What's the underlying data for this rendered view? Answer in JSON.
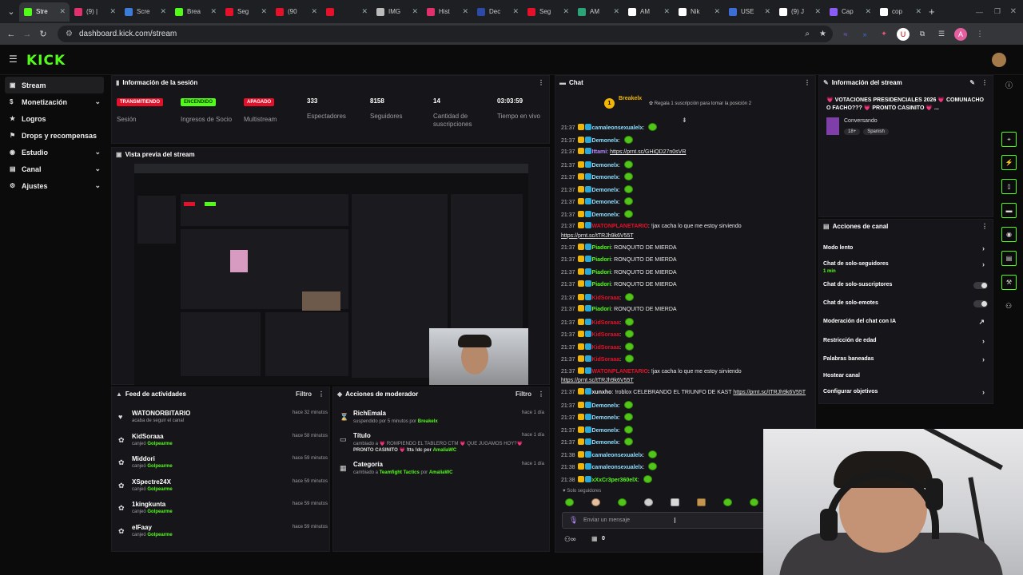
{
  "browser": {
    "tabs": [
      {
        "label": "Stre",
        "color": "#53fc18"
      },
      {
        "label": "(9) |",
        "color": "#e1306c"
      },
      {
        "label": "Scre",
        "color": "#3d7bd9"
      },
      {
        "label": "Brea",
        "color": "#53fc18"
      },
      {
        "label": "Seg",
        "color": "#e5112a"
      },
      {
        "label": "(90",
        "color": "#e5112a"
      },
      {
        "label": "",
        "color": "#e5112a"
      },
      {
        "label": "IMG",
        "color": "#bbbbbb"
      },
      {
        "label": "Hist",
        "color": "#e1306c"
      },
      {
        "label": "Dec",
        "color": "#2c4aa8"
      },
      {
        "label": "Seg",
        "color": "#e5112a"
      },
      {
        "label": "AM",
        "color": "#2aa57a"
      },
      {
        "label": "AM",
        "color": "#ffffff"
      },
      {
        "label": "Nik",
        "color": "#ffffff"
      },
      {
        "label": "USE",
        "color": "#3b6fd6"
      },
      {
        "label": "(9) J",
        "color": "#ffffff"
      },
      {
        "label": "Cap",
        "color": "#8a5cf6"
      },
      {
        "label": "cop",
        "color": "#ffffff"
      }
    ],
    "url": "dashboard.kick.com/stream"
  },
  "header": {
    "logo": "KICK"
  },
  "sidebar": {
    "items": [
      {
        "label": "Stream",
        "chevron": ""
      },
      {
        "label": "Monetización",
        "chevron": "⌄"
      },
      {
        "label": "Logros",
        "chevron": ""
      },
      {
        "label": "Drops y recompensas",
        "chevron": ""
      },
      {
        "label": "Estudio",
        "chevron": "⌄"
      },
      {
        "label": "Canal",
        "chevron": "⌄"
      },
      {
        "label": "Ajustes",
        "chevron": "⌄"
      }
    ]
  },
  "session": {
    "title": "Información de la sesión",
    "items": [
      {
        "badge": "TRANSMITIENDO",
        "label": "Sesión"
      },
      {
        "badge": "ENCENDIDO",
        "label": "Ingresos de Socio"
      },
      {
        "badge": "APAGADO",
        "label": "Multistream"
      },
      {
        "value": "333",
        "label": "Espectadores"
      },
      {
        "value": "8158",
        "label": "Seguidores"
      },
      {
        "value": "14",
        "label": "Cantidad de suscripciones"
      },
      {
        "value": "03:03:59",
        "label": "Tiempo en vivo"
      }
    ]
  },
  "preview": {
    "title": "Vista previa del stream"
  },
  "feed": {
    "title": "Feed de actividades",
    "filter": "Filtro",
    "items": [
      {
        "name": "WATONORBITARIO",
        "sub": "acaba de seguir el canal",
        "reward": "",
        "time": "hace 32 minutos"
      },
      {
        "name": "KidSoraaa",
        "sub": "canjeó",
        "reward": "Golpearme",
        "time": "hace 58 minutos"
      },
      {
        "name": "Middori",
        "sub": "canjeó",
        "reward": "Golpearme",
        "time": "hace 59 minutos"
      },
      {
        "name": "XSpectre24X",
        "sub": "canjeó",
        "reward": "Golpearme",
        "time": "hace 59 minutos"
      },
      {
        "name": "1kingkunta",
        "sub": "canjeó",
        "reward": "Golpearme",
        "time": "hace 59 minutos"
      },
      {
        "name": "elFaay",
        "sub": "canjeó",
        "reward": "Golpearme",
        "time": "hace 59 minutos"
      }
    ]
  },
  "modactions": {
    "title": "Acciones de moderador",
    "filter": "Filtro",
    "items": [
      {
        "name": "RichEmala",
        "line1": "suspendido por 5 minutos por",
        "by": "Breakelx",
        "time": "hace 1 día"
      },
      {
        "name": "Título",
        "line1": "cambiado a 💗 ROMPIENDO EL TABLERO CTM 💗 QUE JUGAMOS HOY?💗",
        "line2": "PRONTO CASINITO 💗 !tts !dc por",
        "by": "AmaliaWC",
        "time": "hace 1 día"
      },
      {
        "name": "Categoría",
        "line1": "cambiado a",
        "cat": "Teamfight Tactics",
        "mid": "por",
        "by": "AmaliaWC",
        "time": "hace 1 día"
      }
    ]
  },
  "chat": {
    "title": "Chat",
    "pinned_user": "Breakelx",
    "pinned_count": "1",
    "pinned_text": "Regala 1 suscripción para tomar la posición 2",
    "lines": [
      {
        "time": "21:37",
        "user": "camaleonsexualelx",
        "color": "#8fdfff",
        "text": "",
        "emote": true
      },
      {
        "time": "21:37",
        "user": "Demonelx",
        "color": "#8fdfff",
        "text": "",
        "emote": true
      },
      {
        "time": "21:37",
        "user": "Ittami",
        "color": "#b388ff",
        "text": "",
        "link": "https://prnt.sc/GHiQD27n0sVR"
      },
      {
        "time": "21:37",
        "user": "Demonelx",
        "color": "#8fdfff",
        "text": "",
        "emote": true
      },
      {
        "time": "21:37",
        "user": "Demonelx",
        "color": "#8fdfff",
        "text": "",
        "emote": true
      },
      {
        "time": "21:37",
        "user": "Demonelx",
        "color": "#8fdfff",
        "text": "",
        "emote": true
      },
      {
        "time": "21:37",
        "user": "Demonelx",
        "color": "#8fdfff",
        "text": "",
        "emote": true
      },
      {
        "time": "21:37",
        "user": "Demonelx",
        "color": "#8fdfff",
        "text": "",
        "emote": true
      },
      {
        "time": "21:37",
        "user": "WATONPLANETARIO",
        "color": "#e5112a",
        "text": "!jax cacha lo que me estoy sirviendo",
        "link2": "https://prnt.sc/tTRJh9k6V55T"
      },
      {
        "time": "21:37",
        "user": "Piadori",
        "color": "#53fc18",
        "text": "RONQUITO DE MIERDA"
      },
      {
        "time": "21:37",
        "user": "Piadori",
        "color": "#53fc18",
        "text": "RONQUITO DE MIERDA"
      },
      {
        "time": "21:37",
        "user": "Piadori",
        "color": "#53fc18",
        "text": "RONQUITO DE MIERDA"
      },
      {
        "time": "21:37",
        "user": "Piadori",
        "color": "#53fc18",
        "text": "RONQUITO DE MIERDA"
      },
      {
        "time": "21:37",
        "user": "KidSoraaa",
        "color": "#e5112a",
        "text": "",
        "emote": true
      },
      {
        "time": "21:37",
        "user": "Piadori",
        "color": "#53fc18",
        "text": "RONQUITO DE MIERDA"
      },
      {
        "time": "21:37",
        "user": "KidSoraaa",
        "color": "#e5112a",
        "text": "",
        "emote": true
      },
      {
        "time": "21:37",
        "user": "KidSoraaa",
        "color": "#e5112a",
        "text": "",
        "emote": true
      },
      {
        "time": "21:37",
        "user": "KidSoraaa",
        "color": "#e5112a",
        "text": "",
        "emote": true
      },
      {
        "time": "21:37",
        "user": "KidSoraaa",
        "color": "#e5112a",
        "text": "",
        "emote": true
      },
      {
        "time": "21:37",
        "user": "WATONPLANETARIO",
        "color": "#e5112a",
        "text": "!jax cacha lo que me estoy sirviendo",
        "link2": "https://prnt.sc/tTRJh9k6V55T"
      },
      {
        "time": "21:37",
        "user": "xunxho",
        "color": "#e8e8e8",
        "text": "!roblox CELEBRANDO EL TRIUNFO DE KAST",
        "link": "https://prnt.sc/tTRJh9k6V55T"
      },
      {
        "time": "21:37",
        "user": "Demonelx",
        "color": "#8fdfff",
        "text": "",
        "emote": true
      },
      {
        "time": "21:37",
        "user": "Demonelx",
        "color": "#8fdfff",
        "text": "",
        "emote": true
      },
      {
        "time": "21:37",
        "user": "Demonelx",
        "color": "#8fdfff",
        "text": "",
        "emote": true
      },
      {
        "time": "21:37",
        "user": "Demonelx",
        "color": "#8fdfff",
        "text": "",
        "emote": true
      },
      {
        "time": "21:38",
        "user": "camaleonsexualelx",
        "color": "#8fdfff",
        "text": "",
        "emote": true
      },
      {
        "time": "21:38",
        "user": "camaleonsexualelx",
        "color": "#8fdfff",
        "text": "",
        "emote": true
      },
      {
        "time": "21:38",
        "user": "xXxCr3per360elX",
        "color": "#53fc18",
        "text": "",
        "emote": true
      }
    ],
    "mode": "Solo seguidores",
    "input_placeholder": "Enviar un mensaje",
    "count": "0"
  },
  "streaminfo": {
    "title": "Información del stream",
    "stream_title": "💗 VOTACIONES PRESIDENCIALES 2026 💗 COMUNACHO O FACHO??? 💗 PRONTO CASINITO 💗 ...",
    "category": "Conversando",
    "tags": [
      "18+",
      "Spanish"
    ]
  },
  "channel": {
    "title": "Acciones de canal",
    "items": [
      {
        "label": "Modo lento",
        "kind": "chevron",
        "sub": ""
      },
      {
        "label": "Chat de solo-seguidores",
        "kind": "chevron",
        "sub": "1 min"
      },
      {
        "label": "Chat de solo-suscriptores",
        "kind": "toggle",
        "sub": ""
      },
      {
        "label": "Chat de solo-emotes",
        "kind": "toggle",
        "sub": ""
      },
      {
        "label": "Moderación del chat con IA",
        "kind": "external",
        "sub": ""
      },
      {
        "label": "Restricción de edad",
        "kind": "chevron",
        "sub": ""
      },
      {
        "label": "Palabras baneadas",
        "kind": "chevron",
        "sub": ""
      },
      {
        "label": "Hostear canal",
        "kind": "none",
        "sub": ""
      },
      {
        "label": "Configurar objetivos",
        "kind": "chevron",
        "sub": ""
      }
    ]
  },
  "colors": {
    "brand": "#53fc18",
    "live": "#e5112a",
    "panel": "#16161a"
  }
}
